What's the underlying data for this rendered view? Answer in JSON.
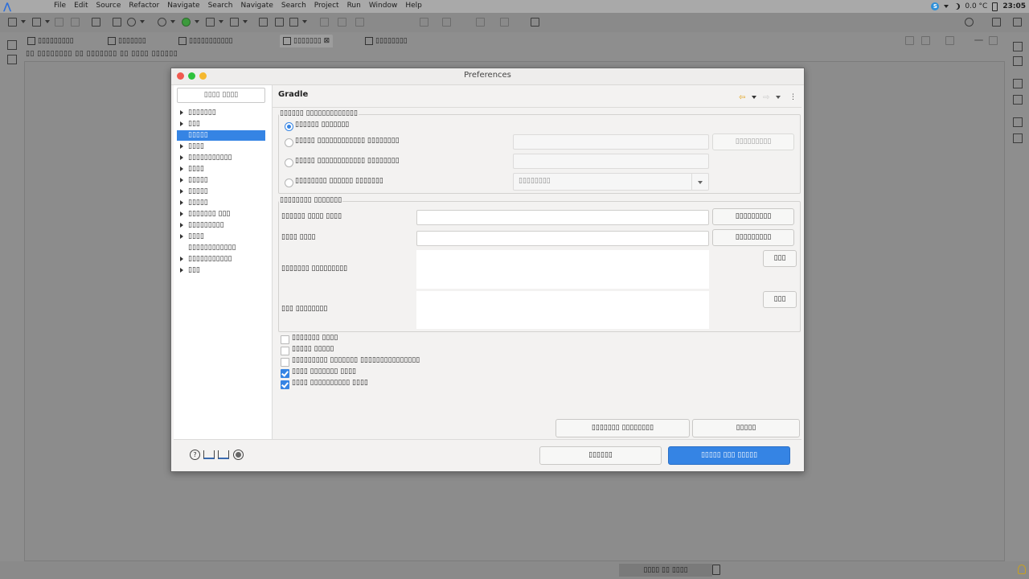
{
  "menubar": {
    "items": [
      "File",
      "Edit",
      "Source",
      "Refactor",
      "Navigate",
      "Search",
      "Navigate",
      "Search",
      "Project",
      "Run",
      "Window",
      "Help"
    ],
    "temperature": "0.0 °C",
    "clock": "23:05"
  },
  "editor": {
    "tabs": [
      "▯▯▯▯▯▯▯▯▯",
      "▯▯▯▯▯▯▯",
      "▯▯▯▯▯▯▯▯▯▯▯",
      "▯▯▯▯▯▯▯",
      "▯▯▯▯▯▯▯▯"
    ],
    "breadcrumb": "▯▯ ▯▯▯▯▯▯▯▯ ▯▯ ▯▯▯▯▯▯▯ ▯▯ ▯▯▯▯ ▯▯▯▯▯▯"
  },
  "status": {
    "heap": "▯▯▯▯ ▯▯ ▯▯▯▯"
  },
  "dialog": {
    "title": "Preferences",
    "filter_placeholder": "▯▯▯▯ ▯▯▯▯",
    "tree": [
      {
        "label": "▯▯▯▯▯▯▯",
        "expandable": true,
        "selected": false
      },
      {
        "label": "▯▯▯",
        "expandable": true,
        "selected": false
      },
      {
        "label": "▯▯▯▯▯",
        "expandable": false,
        "selected": true
      },
      {
        "label": "▯▯▯▯",
        "expandable": true,
        "selected": false
      },
      {
        "label": "▯▯▯▯▯▯▯▯▯▯▯",
        "expandable": true,
        "selected": false
      },
      {
        "label": "▯▯▯▯",
        "expandable": true,
        "selected": false
      },
      {
        "label": "▯▯▯▯▯",
        "expandable": true,
        "selected": false
      },
      {
        "label": "▯▯▯▯▯",
        "expandable": true,
        "selected": false
      },
      {
        "label": "▯▯▯▯▯",
        "expandable": true,
        "selected": false
      },
      {
        "label": "▯▯▯▯▯▯▯ ▯▯▯",
        "expandable": true,
        "selected": false
      },
      {
        "label": "▯▯▯▯▯▯▯▯▯",
        "expandable": true,
        "selected": false
      },
      {
        "label": "▯▯▯▯",
        "expandable": true,
        "selected": false
      },
      {
        "label": "▯▯▯▯▯▯▯▯▯▯▯▯",
        "expandable": false,
        "selected": false
      },
      {
        "label": "▯▯▯▯▯▯▯▯▯▯▯",
        "expandable": true,
        "selected": false
      },
      {
        "label": "▯▯▯",
        "expandable": true,
        "selected": false
      }
    ],
    "page_title": "Gradle",
    "distribution": {
      "label": "▯▯▯▯▯▯ ▯▯▯▯▯▯▯▯▯▯▯▯▯",
      "options": [
        "▯▯▯▯▯▯ ▯▯▯▯▯▯▯",
        "▯▯▯▯▯ ▯▯▯▯▯▯▯▯▯▯▯▯ ▯▯▯▯▯▯▯▯",
        "▯▯▯▯▯ ▯▯▯▯▯▯▯▯▯▯▯▯ ▯▯▯▯▯▯▯▯",
        "▯▯▯▯▯▯▯▯ ▯▯▯▯▯▯ ▯▯▯▯▯▯▯"
      ],
      "browse_label": "▯▯▯▯▯▯▯▯▯",
      "version_value": "▯▯▯▯▯▯▯▯"
    },
    "advanced": {
      "label": "▯▯▯▯▯▯▯▯ ▯▯▯▯▯▯▯",
      "user_home_label": "▯▯▯▯▯▯ ▯▯▯▯ ▯▯▯▯",
      "java_home_label": "▯▯▯▯ ▯▯▯▯",
      "browse1": "▯▯▯▯▯▯▯▯▯",
      "browse2": "▯▯▯▯▯▯▯▯▯",
      "program_args_label": "▯▯▯▯▯▯▯ ▯▯▯▯▯▯▯▯▯",
      "jvm_args_label": "▯▯▯ ▯▯▯▯▯▯▯▯",
      "add1": "▯▯▯",
      "add2": "▯▯▯"
    },
    "checks": [
      {
        "label": "▯▯▯▯▯▯▯ ▯▯▯▯",
        "checked": false
      },
      {
        "label": "▯▯▯▯▯ ▯▯▯▯▯",
        "checked": false
      },
      {
        "label": "▯▯▯▯▯▯▯▯▯ ▯▯▯▯▯▯▯ ▯▯▯▯▯▯▯▯▯▯▯▯▯▯▯",
        "checked": false
      },
      {
        "label": "▯▯▯▯ ▯▯▯▯▯▯▯ ▯▯▯▯",
        "checked": true
      },
      {
        "label": "▯▯▯▯ ▯▯▯▯▯▯▯▯▯▯ ▯▯▯▯",
        "checked": true
      }
    ],
    "restore_defaults": "▯▯▯▯▯▯▯ ▯▯▯▯▯▯▯▯",
    "apply": "▯▯▯▯▯",
    "cancel": "▯▯▯▯▯▯",
    "apply_close": "▯▯▯▯▯ ▯▯▯ ▯▯▯▯▯",
    "accent_color": "#3584e4"
  }
}
